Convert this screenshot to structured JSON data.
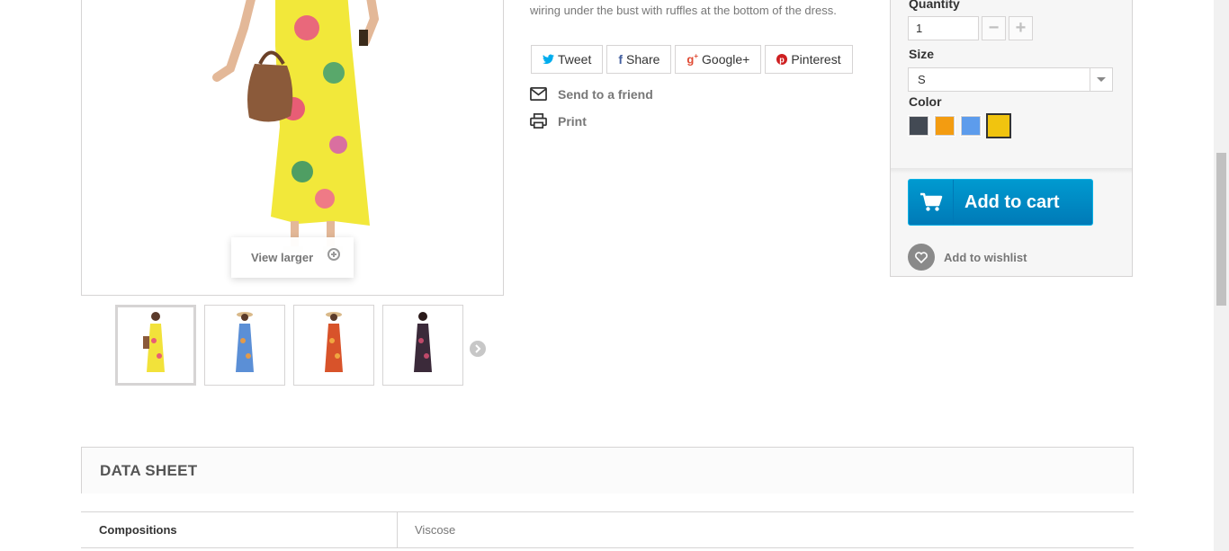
{
  "product": {
    "description_line": "wiring under the bust with ruffles at the bottom of the dress.",
    "view_larger": "View larger"
  },
  "share": {
    "tweet": "Tweet",
    "share": "Share",
    "googleplus": "Google+",
    "pinterest": "Pinterest"
  },
  "links": {
    "send_to_friend": "Send to a friend",
    "print": "Print"
  },
  "cart_box": {
    "quantity_label": "Quantity",
    "quantity_value": "1",
    "size_label": "Size",
    "size_value": "S",
    "color_label": "Color",
    "colors": [
      "#434a54",
      "#f39c11",
      "#5d9cec",
      "#f1c40f"
    ],
    "selected_color_index": 3,
    "add_to_cart": "Add to cart",
    "add_to_wishlist": "Add to wishlist"
  },
  "thumbnails": [
    {
      "dress_color": "#f2e23a",
      "accent": "#e85d75"
    },
    {
      "dress_color": "#5b8fd6",
      "accent": "#e39a4a"
    },
    {
      "dress_color": "#d8532a",
      "accent": "#f0a640"
    },
    {
      "dress_color": "#3b2a3a",
      "accent": "#c04a6a"
    }
  ],
  "data_sheet": {
    "title": "DATA SHEET",
    "rows": [
      {
        "key": "Compositions",
        "value": "Viscose"
      }
    ]
  }
}
